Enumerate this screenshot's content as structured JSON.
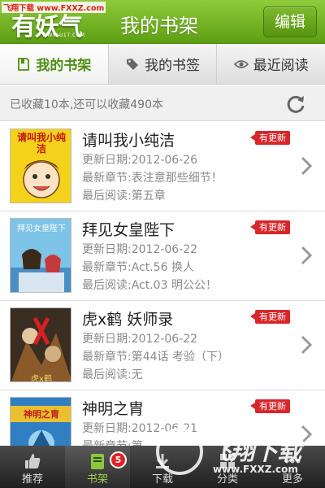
{
  "watermark_top": "飞翔下载 www.FXXZ.com",
  "header": {
    "logo_text": "有妖气",
    "logo_url": "WWW.U17.COM",
    "title": "我的书架",
    "edit_label": "编辑"
  },
  "tabs": [
    {
      "label": "我的书架",
      "icon": "book-icon",
      "active": true
    },
    {
      "label": "我的书签",
      "icon": "tag-icon",
      "active": false
    },
    {
      "label": "最近阅读",
      "icon": "eye-icon",
      "active": false
    }
  ],
  "status": {
    "text": "已收藏10本,还可以收藏490本",
    "icon": "refresh-icon"
  },
  "books": [
    {
      "title": "请叫我小纯洁",
      "cover_text": "请叫我小纯洁",
      "updated": "更新日期:2012-06-26",
      "latest": "最新章节:表注意那些细节！",
      "last_read": "最后阅读:第五章",
      "badge": "有更新"
    },
    {
      "title": "拜见女皇陛下",
      "cover_text": "拜见女皇陛下",
      "updated": "更新日期:2012-06-22",
      "latest": "最新章节:Act.56 换人",
      "last_read": "最后阅读:Act.03 明公公！",
      "badge": "有更新"
    },
    {
      "title": "虎x鹤 妖师录",
      "cover_text": "虎x鹤",
      "updated": "更新日期:2012-06-22",
      "latest": "最新章节:第44话 考验（下）",
      "last_read": "最后阅读:无",
      "badge": "有更新"
    },
    {
      "title": "神明之胄",
      "cover_text": "神明之胄",
      "updated": "更新日期:2012-06-21",
      "latest": "最新章节:第",
      "last_read": "",
      "badge": "有更新"
    }
  ],
  "nav": [
    {
      "label": "推荐",
      "icon": "thumbs-up-icon",
      "active": false
    },
    {
      "label": "书架",
      "icon": "bookshelf-icon",
      "active": true,
      "badge": "5"
    },
    {
      "label": "下载",
      "icon": "download-icon",
      "active": false
    },
    {
      "label": "分类",
      "icon": "category-icon",
      "active": false
    },
    {
      "label": "更多",
      "icon": "more-icon",
      "active": false
    }
  ],
  "watermark_bottom": {
    "text": "飞翔下载",
    "url": "www.FXXZ.com"
  },
  "colors": {
    "header_green": "#6aab1e",
    "badge_red": "#d8262b",
    "active_tab_text": "#4f8f14"
  }
}
